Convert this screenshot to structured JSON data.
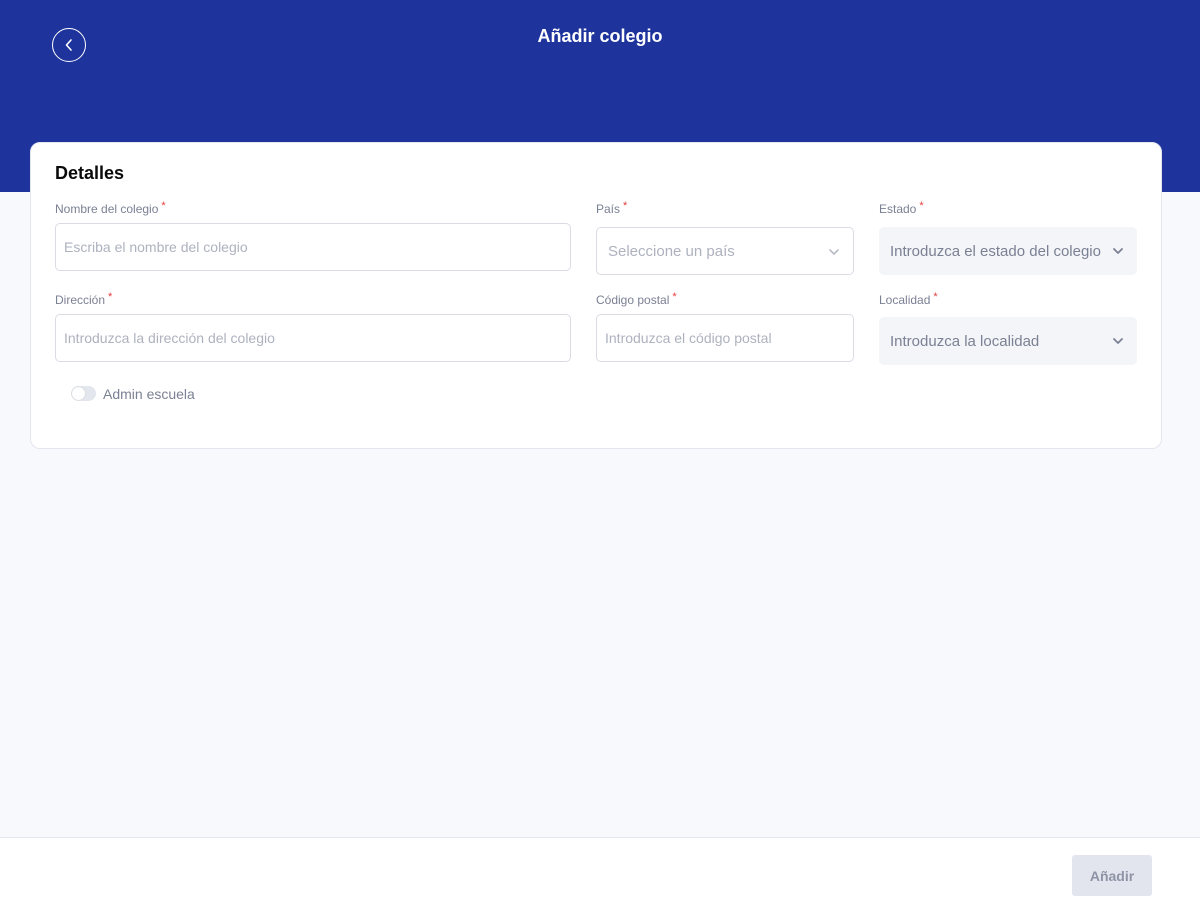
{
  "header": {
    "title": "Añadir colegio",
    "back_icon": "chevron-left-icon",
    "background_color": "#1e349c"
  },
  "card": {
    "title": "Detalles",
    "required_marker": "*",
    "fields": {
      "school_name": {
        "label": "Nombre del colegio",
        "value": "",
        "placeholder": "Escriba el nombre del colegio"
      },
      "country": {
        "label": "País",
        "selected": "Seleccione un país"
      },
      "state": {
        "label": "Estado",
        "selected": "Introduzca el estado del colegio"
      },
      "address": {
        "label": "Dirección",
        "value": "",
        "placeholder": "Introduzca la dirección del colegio"
      },
      "postal_code": {
        "label": "Código postal",
        "value": "",
        "placeholder": "Introduzca el código postal"
      },
      "locality": {
        "label": "Localidad",
        "selected": "Introduzca la localidad"
      }
    },
    "admin_toggle": {
      "label": "Admin escuela",
      "checked": false
    }
  },
  "footer": {
    "add_label": "Añadir",
    "add_disabled": true
  },
  "colors": {
    "required": "#e23b3b",
    "disabled_button_bg": "#e2e5ee"
  }
}
